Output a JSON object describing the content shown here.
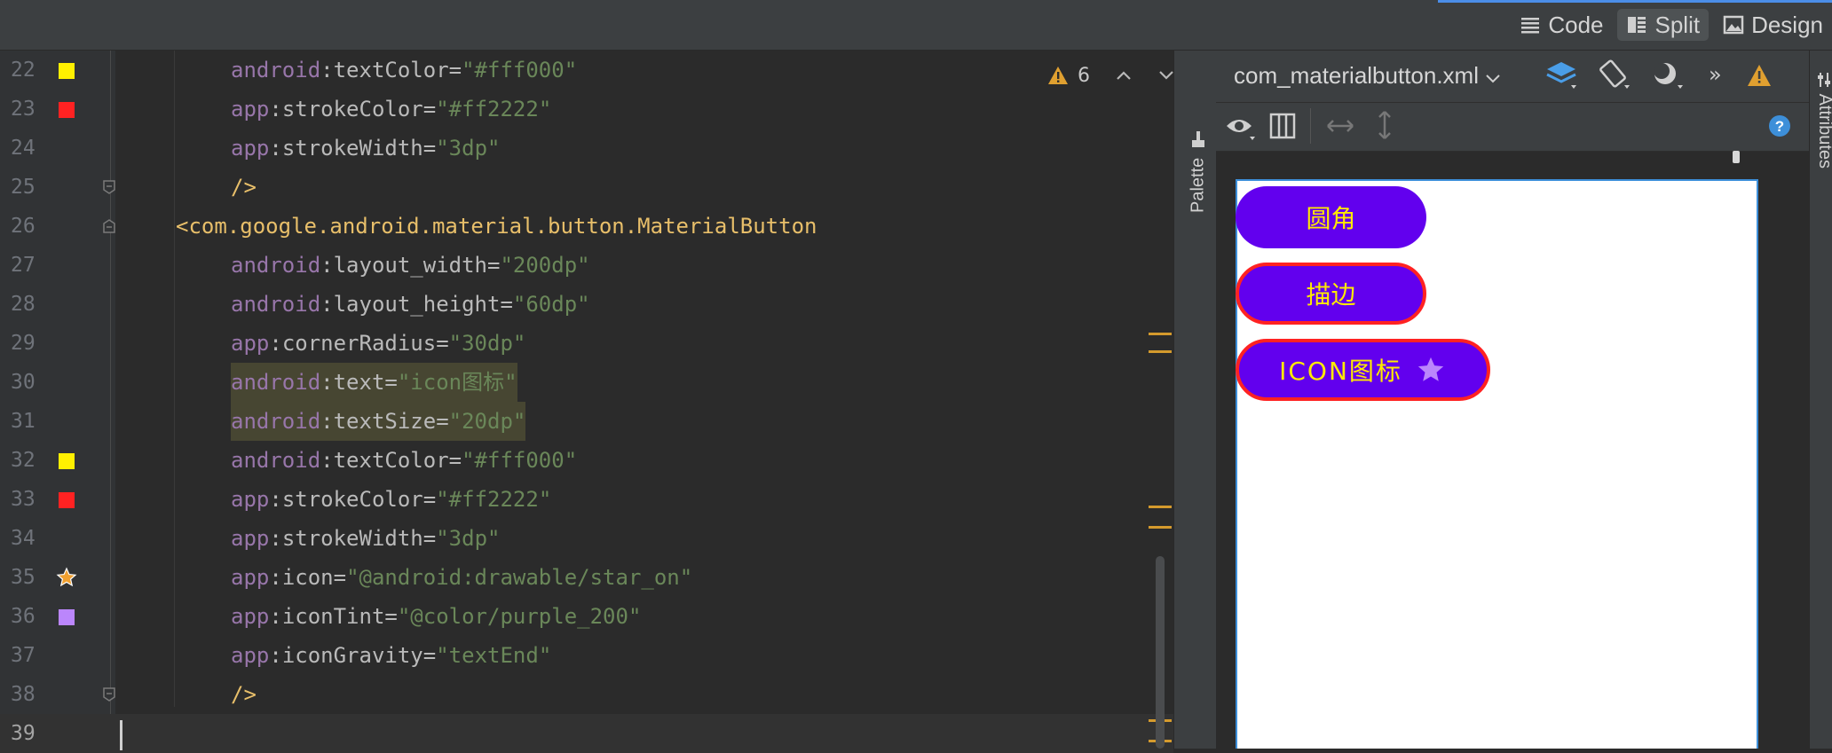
{
  "view_modes": [
    {
      "label": "Code",
      "icon": "code-lines-icon"
    },
    {
      "label": "Split",
      "icon": "split-view-icon"
    },
    {
      "label": "Design",
      "icon": "image-icon"
    }
  ],
  "editor": {
    "warnings_count": "6",
    "lines": [
      {
        "num": "22",
        "ns": "android",
        "attr": "textColor",
        "val": "\"#fff000\"",
        "marker": "color-yellow"
      },
      {
        "num": "23",
        "ns": "app",
        "attr": "strokeColor",
        "val": "\"#ff2222\"",
        "marker": "color-red"
      },
      {
        "num": "24",
        "ns": "app",
        "attr": "strokeWidth",
        "val": "\"3dp\""
      },
      {
        "num": "25",
        "close": "/>"
      },
      {
        "num": "26",
        "tag": "<com.google.android.material.button.MaterialButton"
      },
      {
        "num": "27",
        "ns": "android",
        "attr": "layout_width",
        "val": "\"200dp\""
      },
      {
        "num": "28",
        "ns": "android",
        "attr": "layout_height",
        "val": "\"60dp\""
      },
      {
        "num": "29",
        "ns": "app",
        "attr": "cornerRadius",
        "val": "\"30dp\""
      },
      {
        "num": "30",
        "ns": "android",
        "attr": "text",
        "val": "\"icon图标\""
      },
      {
        "num": "31",
        "ns": "android",
        "attr": "textSize",
        "val": "\"20dp\""
      },
      {
        "num": "32",
        "ns": "android",
        "attr": "textColor",
        "val": "\"#fff000\"",
        "marker": "color-yellow"
      },
      {
        "num": "33",
        "ns": "app",
        "attr": "strokeColor",
        "val": "\"#ff2222\"",
        "marker": "color-red"
      },
      {
        "num": "34",
        "ns": "app",
        "attr": "strokeWidth",
        "val": "\"3dp\""
      },
      {
        "num": "35",
        "ns": "app",
        "attr": "icon",
        "val": "\"@android:drawable/star_on\"",
        "marker": "star"
      },
      {
        "num": "36",
        "ns": "app",
        "attr": "iconTint",
        "val": "\"@color/purple_200\"",
        "marker": "color-purple"
      },
      {
        "num": "37",
        "ns": "app",
        "attr": "iconGravity",
        "val": "\"textEnd\""
      },
      {
        "num": "38",
        "close": "/>"
      },
      {
        "num": "39"
      }
    ]
  },
  "palette_label": "Palette",
  "attributes_label": "Attributes",
  "design": {
    "filename": "com_materialbutton.xml",
    "buttons": [
      "圆角",
      "描边",
      "ICON图标"
    ]
  },
  "colors": {
    "button_bg": "#6200ee",
    "button_text": "#ffea00",
    "stroke": "#ff2222",
    "icon_tint": "#bb86fc"
  }
}
